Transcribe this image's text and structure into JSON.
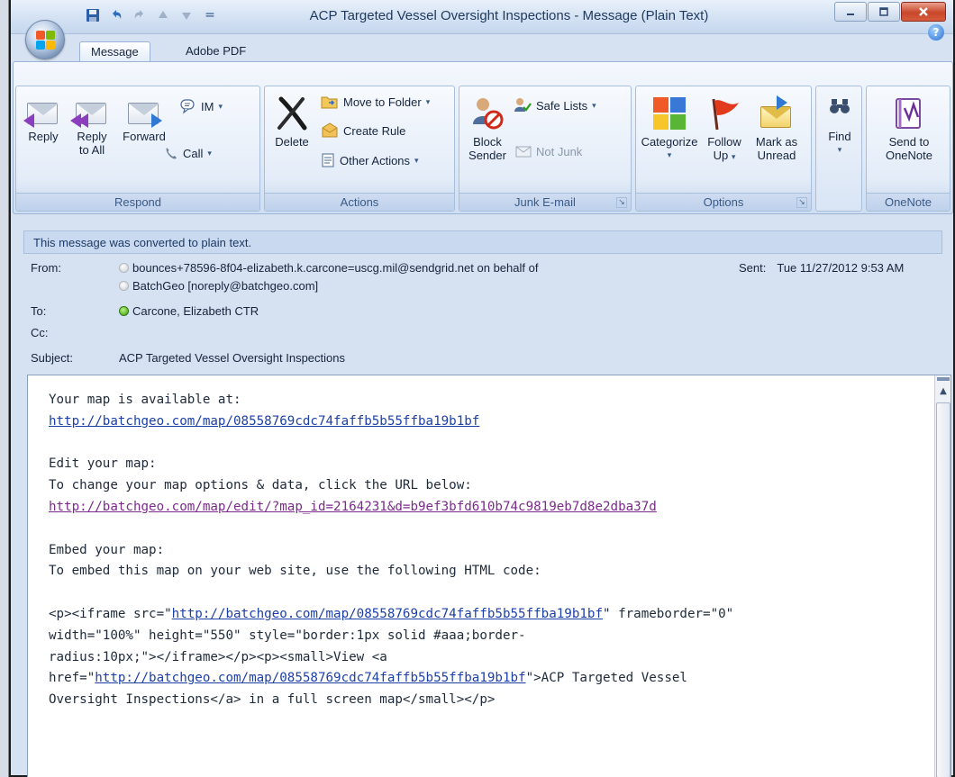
{
  "window": {
    "title": "ACP Targeted Vessel Oversight Inspections - Message (Plain Text)",
    "qat_dropdown": "="
  },
  "tabs": [
    {
      "label": "Message",
      "active": true
    },
    {
      "label": "Adobe PDF",
      "active": false
    }
  ],
  "ribbon": {
    "respond": {
      "label": "Respond",
      "reply": "Reply",
      "reply_all_1": "Reply",
      "reply_all_2": "to All",
      "forward": "Forward",
      "im": "IM",
      "call": "Call"
    },
    "actions": {
      "label": "Actions",
      "delete": "Delete",
      "move_to_folder": "Move to Folder",
      "create_rule": "Create Rule",
      "other_actions": "Other Actions"
    },
    "junk": {
      "label": "Junk E-mail",
      "block_sender_1": "Block",
      "block_sender_2": "Sender",
      "safe_lists": "Safe Lists",
      "not_junk": "Not Junk"
    },
    "options": {
      "label": "Options",
      "categorize": "Categorize",
      "follow_up_1": "Follow",
      "follow_up_2": "Up",
      "mark_unread_1": "Mark as",
      "mark_unread_2": "Unread"
    },
    "find": {
      "label": "Find"
    },
    "onenote": {
      "label": "OneNote",
      "send_1": "Send to",
      "send_2": "OneNote"
    },
    "caret": "▾"
  },
  "header": {
    "info_bar": "This message was converted to plain text.",
    "from_label": "From:",
    "from_line1": "bounces+78596-8f04-elizabeth.k.carcone=uscg.mil@sendgrid.net on behalf of",
    "from_line2": "BatchGeo [noreply@batchgeo.com]",
    "sent_label": "Sent:",
    "sent_value": "Tue 11/27/2012 9:53 AM",
    "to_label": "To:",
    "to_value": "Carcone, Elizabeth CTR",
    "cc_label": "Cc:",
    "subject_label": "Subject:",
    "subject_value": "ACP Targeted Vessel Oversight Inspections"
  },
  "body": {
    "l1": "Your map is available at:",
    "l2_link": "http://batchgeo.com/map/08558769cdc74faffb5b55ffba19b1bf",
    "l4": "Edit your map:",
    "l5": "To change your map options & data, click the URL below:",
    "l6_link": "http://batchgeo.com/map/edit/?map_id=2164231&d=b9ef3bfd610b74c9819eb7d8e2dba37d",
    "l8": "Embed your map:",
    "l9": "To embed this map on your web site, use the following HTML code:",
    "l11_a": "<p><iframe src=\"",
    "l11_link": "http://batchgeo.com/map/08558769cdc74faffb5b55ffba19b1bf",
    "l11_b": "\" frameborder=\"0\"",
    "l12": "width=\"100%\" height=\"550\" style=\"border:1px solid #aaa;border-",
    "l13": "radius:10px;\"></iframe></p><p><small>View <a",
    "l14_a": "href=\"",
    "l14_link": "http://batchgeo.com/map/08558769cdc74faffb5b55ffba19b1bf",
    "l14_b": "\">ACP Targeted Vessel",
    "l15": "Oversight Inspections</a> in a full screen map</small></p>"
  }
}
